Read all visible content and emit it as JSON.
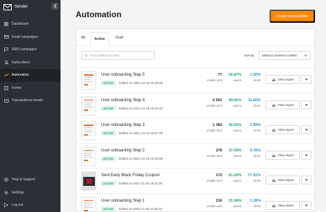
{
  "sidebar": {
    "brand": "Sender",
    "items": [
      {
        "label": "Dashboard",
        "icon": "dashboard-icon"
      },
      {
        "label": "Email campaigns",
        "icon": "mail-icon"
      },
      {
        "label": "SMS campaigns",
        "icon": "sms-icon"
      },
      {
        "label": "Subscribers",
        "icon": "users-icon"
      },
      {
        "label": "Automation",
        "icon": "automation-icon",
        "active": true
      },
      {
        "label": "Forms",
        "icon": "forms-icon"
      },
      {
        "label": "Transactional emails",
        "icon": "transactional-icon"
      }
    ],
    "bottom_items": [
      {
        "label": "Help & Support",
        "icon": "help-icon"
      },
      {
        "label": "Settings",
        "icon": "gear-icon"
      },
      {
        "label": "Log out",
        "icon": "logout-icon"
      }
    ]
  },
  "header": {
    "title": "Automation",
    "create_button": "Create new workflow"
  },
  "tabs": {
    "all": "All",
    "active": "Active",
    "draft": "Draft"
  },
  "search": {
    "placeholder": "Find workflow by name"
  },
  "sort": {
    "label": "Sort by",
    "value": "Edited at (newest to oldest)"
  },
  "labels": {
    "emails_sent": "emails sent",
    "opens": "opens",
    "clicks": "clicks",
    "view_report": "View report"
  },
  "workflows": [
    {
      "name": "User onboarding Step 5",
      "status": "ACTIVE",
      "edited": "Edited on 2021-12-16 19:25:28",
      "emails_sent": "77",
      "opens": "29.87%",
      "clicks": "1.30%"
    },
    {
      "name": "User onboarding Step 4",
      "status": "ACTIVE",
      "edited": "Edited on 2021-12-16 18:43:44",
      "emails_sent": "6 561",
      "opens": "44.81%",
      "clicks": "11.60%"
    },
    {
      "name": "User onboarding Step 3",
      "status": "ACTIVE",
      "edited": "Edited on 2021-12-16 18:37:05",
      "emails_sent": "1 382",
      "opens": "30.61%",
      "clicks": "2.89%"
    },
    {
      "name": "User onboarding Step 2",
      "status": "ACTIVE",
      "edited": "Edited on 2021-12-16 18:33:56",
      "emails_sent": "278",
      "opens": "37.05%",
      "clicks": "5.76%"
    },
    {
      "name": "Sent Early Black Friday Coupon",
      "status": "ACTIVE",
      "edited": "Edited on 2021-11-15 15:22:26",
      "emails_sent": "172",
      "opens": "61.63%",
      "clicks": "77.91%"
    },
    {
      "name": "User onboarding Step 1",
      "status": "ACTIVE",
      "edited": "Edited on 2021-11-15 11:55:33",
      "emails_sent": "216",
      "opens": "31.94%",
      "clicks": "1.39%"
    }
  ],
  "colors": {
    "sidebar_bg": "#2b2f36",
    "accent": "#ff8a00",
    "opens": "#17a05d",
    "clicks": "#1f8fd6",
    "badge_bg": "#d9f4e7"
  }
}
